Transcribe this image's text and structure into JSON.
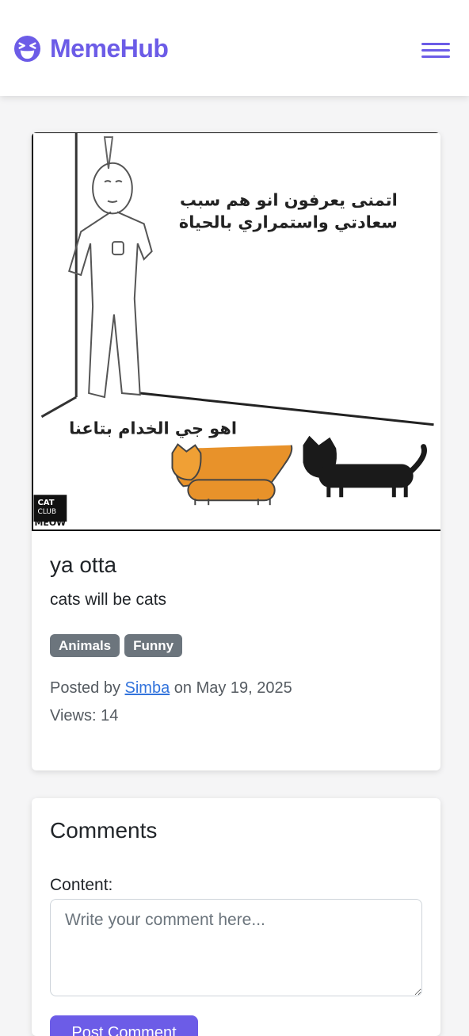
{
  "brand": {
    "name": "MemeHub",
    "icon": "laughing-face-icon",
    "color": "#6c5ce7"
  },
  "nav": {
    "menu_icon": "hamburger-menu-icon"
  },
  "meme": {
    "title": "ya otta",
    "description": "cats will be cats",
    "image": {
      "caption_top_line1": "اتمنى يعرفون انو هم سبب",
      "caption_top_line2": "سعادتي واستمراري بالحياة",
      "caption_bottom": "اهو جي الخدام بتاعنا",
      "watermark_line1": "CAT",
      "watermark_line2": "CLUB",
      "watermark_line3": "MEOW"
    },
    "tags": [
      "Animals",
      "Funny"
    ],
    "posted_prefix": "Posted by",
    "author": "Simba",
    "posted_on_prefix": "on",
    "date": "May 19, 2025",
    "views_label": "Views:",
    "views_count": "14"
  },
  "comments": {
    "title": "Comments",
    "content_label": "Content:",
    "placeholder": "Write your comment here...",
    "submit_label": "Post Comment"
  },
  "colors": {
    "accent": "#6c5ce7",
    "tag_bg": "#6c757d",
    "link": "#3273dc",
    "page_bg": "#f5f5f6"
  }
}
